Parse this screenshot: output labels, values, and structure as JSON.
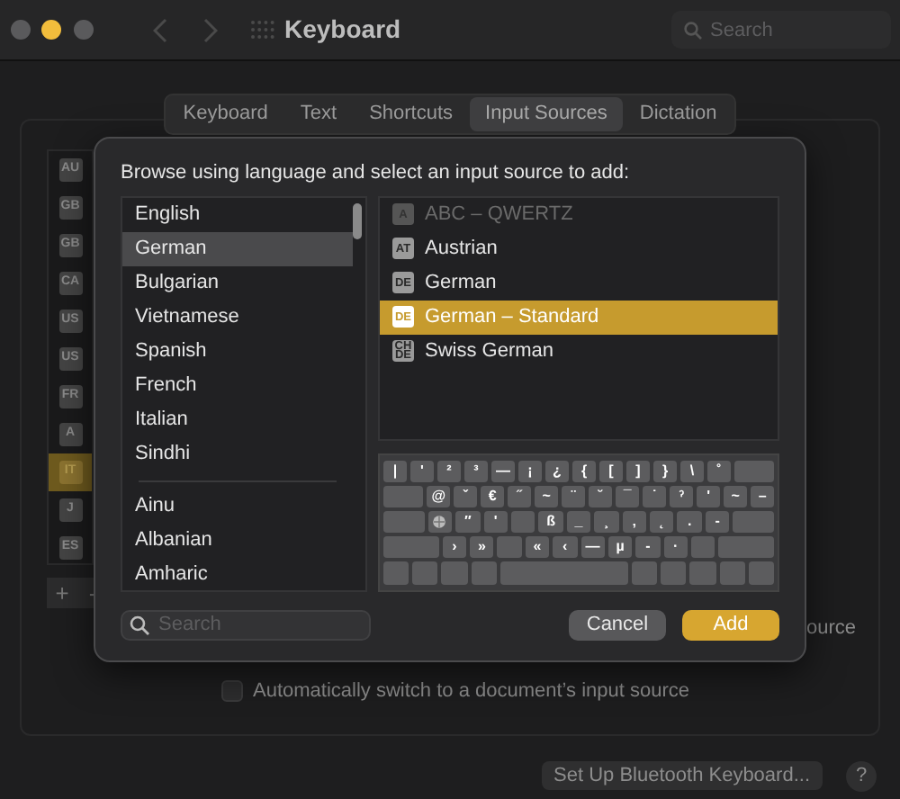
{
  "window": {
    "title": "Keyboard",
    "traffic_lights": [
      {
        "color": "#5a5a5c"
      },
      {
        "color": "#f2bd3c"
      },
      {
        "color": "#5a5a5c"
      }
    ],
    "search": {
      "placeholder": "Search"
    }
  },
  "tabs": [
    {
      "label": "Keyboard",
      "selected": false
    },
    {
      "label": "Text",
      "selected": false
    },
    {
      "label": "Shortcuts",
      "selected": false
    },
    {
      "label": "Input Sources",
      "selected": true
    },
    {
      "label": "Dictation",
      "selected": false
    }
  ],
  "sidebar": {
    "items": [
      {
        "badge": "AU",
        "selected": false
      },
      {
        "badge": "GB",
        "selected": false
      },
      {
        "badge": "GB",
        "selected": false
      },
      {
        "badge": "CA",
        "selected": false
      },
      {
        "badge": "US",
        "selected": false
      },
      {
        "badge": "US",
        "selected": false
      },
      {
        "badge": "FR",
        "selected": false
      },
      {
        "badge": "A",
        "selected": false
      },
      {
        "badge": "IT",
        "selected": true
      },
      {
        "badge": "J",
        "selected": false
      },
      {
        "badge": "ES",
        "selected": false
      }
    ],
    "buttons": [
      "+",
      "-"
    ]
  },
  "background_text": "ource",
  "auto_switch": {
    "label": "Automatically switch to a document’s input source",
    "checked": false
  },
  "bluetooth_button": "Set Up Bluetooth Keyboard...",
  "help_button": "?",
  "sheet": {
    "heading": "Browse using language and select an input source to add:",
    "language_groups": [
      [
        {
          "label": "English",
          "selected": false
        },
        {
          "label": "German",
          "selected": true
        },
        {
          "label": "Bulgarian",
          "selected": false
        },
        {
          "label": "Vietnamese",
          "selected": false
        },
        {
          "label": "Spanish",
          "selected": false
        },
        {
          "label": "French",
          "selected": false
        },
        {
          "label": "Italian",
          "selected": false
        },
        {
          "label": "Sindhi",
          "selected": false
        }
      ],
      [
        {
          "label": "Ainu",
          "selected": false
        },
        {
          "label": "Albanian",
          "selected": false
        },
        {
          "label": "Amharic",
          "selected": false
        }
      ]
    ],
    "sources": [
      {
        "badge": "A",
        "label": "ABC – QWERTZ",
        "disabled": true,
        "selected": false
      },
      {
        "badge": "AT",
        "label": "Austrian",
        "disabled": false,
        "selected": false
      },
      {
        "badge": "DE",
        "label": "German",
        "disabled": false,
        "selected": false
      },
      {
        "badge": "DE",
        "label": "German – Standard",
        "disabled": false,
        "selected": true
      },
      {
        "badge": "CH DE",
        "label": "Swiss German",
        "disabled": false,
        "selected": false
      }
    ],
    "keyboard_rows": [
      [
        {
          "label": "|"
        },
        {
          "label": "'"
        },
        {
          "label": "²"
        },
        {
          "label": "³"
        },
        {
          "label": "—"
        },
        {
          "label": "¡"
        },
        {
          "label": "¿"
        },
        {
          "label": "{"
        },
        {
          "label": "["
        },
        {
          "label": "]"
        },
        {
          "label": "}"
        },
        {
          "label": "\\"
        },
        {
          "label": "˚"
        },
        {
          "kind": "wide"
        }
      ],
      [
        {
          "kind": "wide"
        },
        {
          "label": "@"
        },
        {
          "label": "ˇ"
        },
        {
          "label": "€"
        },
        {
          "label": "˝"
        },
        {
          "label": "~"
        },
        {
          "label": "¨"
        },
        {
          "label": "˘"
        },
        {
          "label": "¯"
        },
        {
          "label": "˙"
        },
        {
          "label": "ˀ"
        },
        {
          "label": "'"
        },
        {
          "label": "~"
        },
        {
          "label": "–"
        }
      ],
      [
        {
          "kind": "wide"
        },
        {
          "kind": "globe"
        },
        {
          "label": "″"
        },
        {
          "label": "'"
        },
        {
          "kind": "blank"
        },
        {
          "label": "ß"
        },
        {
          "label": "_"
        },
        {
          "label": "¸"
        },
        {
          "label": "‚"
        },
        {
          "label": "˛"
        },
        {
          "label": "."
        },
        {
          "label": "-"
        },
        {
          "kind": "wide"
        }
      ],
      [
        {
          "kind": "wider"
        },
        {
          "label": "›"
        },
        {
          "label": "»"
        },
        {
          "kind": "blank"
        },
        {
          "label": "«"
        },
        {
          "label": "‹"
        },
        {
          "label": "—"
        },
        {
          "label": "µ"
        },
        {
          "label": "-"
        },
        {
          "label": "·"
        },
        {
          "kind": "blank"
        },
        {
          "kind": "wider"
        }
      ],
      [
        {
          "kind": "blank"
        },
        {
          "kind": "blank"
        },
        {
          "kind": "blank"
        },
        {
          "kind": "blank"
        },
        {
          "kind": "space"
        },
        {
          "kind": "blank"
        },
        {
          "kind": "blank"
        },
        {
          "kind": "blank"
        },
        {
          "kind": "blank"
        },
        {
          "kind": "blank"
        }
      ]
    ],
    "search": {
      "placeholder": "Search"
    },
    "buttons": [
      {
        "label": "Cancel",
        "kind": "secondary"
      },
      {
        "label": "Add",
        "kind": "primary"
      }
    ]
  }
}
